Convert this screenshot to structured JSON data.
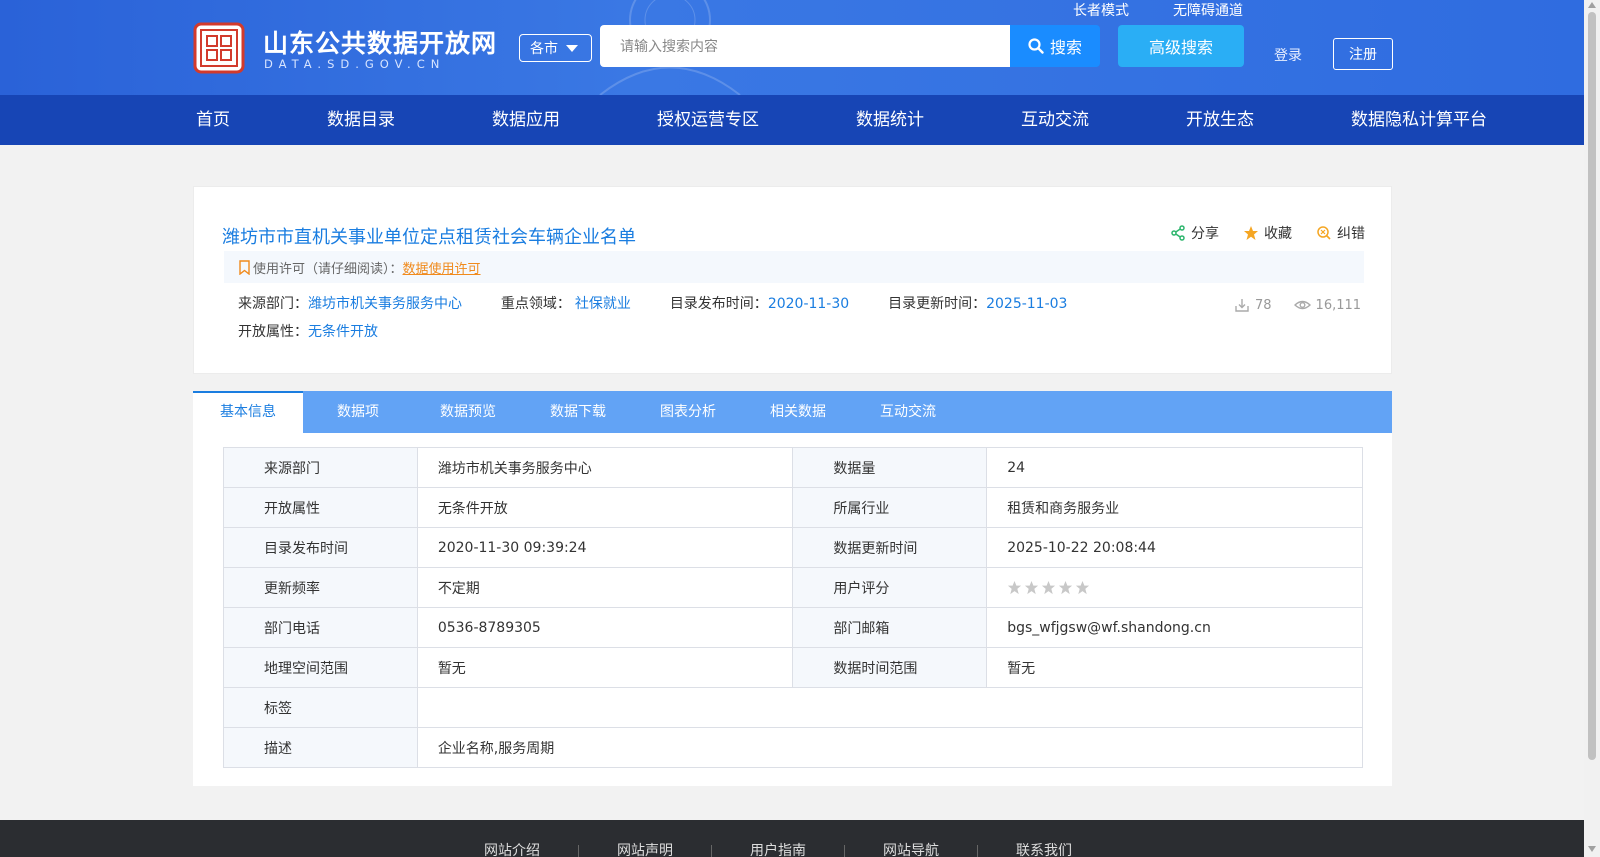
{
  "header": {
    "site_name": "山东公共数据开放网",
    "site_domain": "DATA.SD.GOV.CN",
    "top_links": [
      "长者模式",
      "无障碍通道"
    ],
    "city_select": "各市",
    "search_placeholder": "请输入搜索内容",
    "search_label": "搜索",
    "advanced_search_label": "高级搜索",
    "login_label": "登录",
    "register_label": "注册"
  },
  "nav": {
    "items": [
      "首页",
      "数据目录",
      "数据应用",
      "授权运营专区",
      "数据统计",
      "互动交流",
      "开放生态",
      "数据隐私计算平台"
    ]
  },
  "summary": {
    "title": "潍坊市市直机关事业单位定点租赁社会车辆企业名单",
    "actions": {
      "share": "分享",
      "favorite": "收藏",
      "correct": "纠错"
    },
    "license_prefix": "使用许可（请仔细阅读）：",
    "license_link": "数据使用许可",
    "source_label": "来源部门：",
    "source_value": "潍坊市机关事务服务中心",
    "domain_label": "重点领域：",
    "domain_value": "社保就业",
    "publish_label": "目录发布时间：",
    "publish_value": "2020-11-30",
    "update_label": "目录更新时间：",
    "update_value": "2025-11-03",
    "open_label": "开放属性：",
    "open_value": "无条件开放",
    "download_count": "78",
    "view_count": "16,111"
  },
  "tabs": [
    "基本信息",
    "数据项",
    "数据预览",
    "数据下载",
    "图表分析",
    "相关数据",
    "互动交流"
  ],
  "info_table": {
    "rows": [
      {
        "k1": "来源部门",
        "v1": "潍坊市机关事务服务中心",
        "k2": "数据量",
        "v2": "24"
      },
      {
        "k1": "开放属性",
        "v1": "无条件开放",
        "k2": "所属行业",
        "v2": "租赁和商务服务业"
      },
      {
        "k1": "目录发布时间",
        "v1": "2020-11-30 09:39:24",
        "k2": "数据更新时间",
        "v2": "2025-10-22 20:08:44"
      },
      {
        "k1": "更新频率",
        "v1": "不定期",
        "k2": "用户评分",
        "v2": ""
      },
      {
        "k1": "部门电话",
        "v1": "0536-8789305",
        "k2": "部门邮箱",
        "v2": "bgs_wfjgsw@wf.shandong.cn"
      },
      {
        "k1": "地理空间范围",
        "v1": "暂无",
        "k2": "数据时间范围",
        "v2": "暂无"
      }
    ],
    "tags_label": "标签",
    "tags_value": "",
    "desc_label": "描述",
    "desc_value": "企业名称,服务周期",
    "rating_stars": 0,
    "rating_max": 5
  },
  "footer": {
    "links": [
      "网站介绍",
      "网站声明",
      "用户指南",
      "网站导航",
      "联系我们"
    ]
  },
  "colors": {
    "header_bg": "#2f6ce0",
    "nav_bg": "#1745b5",
    "accent_blue": "#1a7de0",
    "tab_bar": "#62a3f5",
    "license_link": "#f08a1c",
    "footer_bg": "#2b2d31"
  }
}
